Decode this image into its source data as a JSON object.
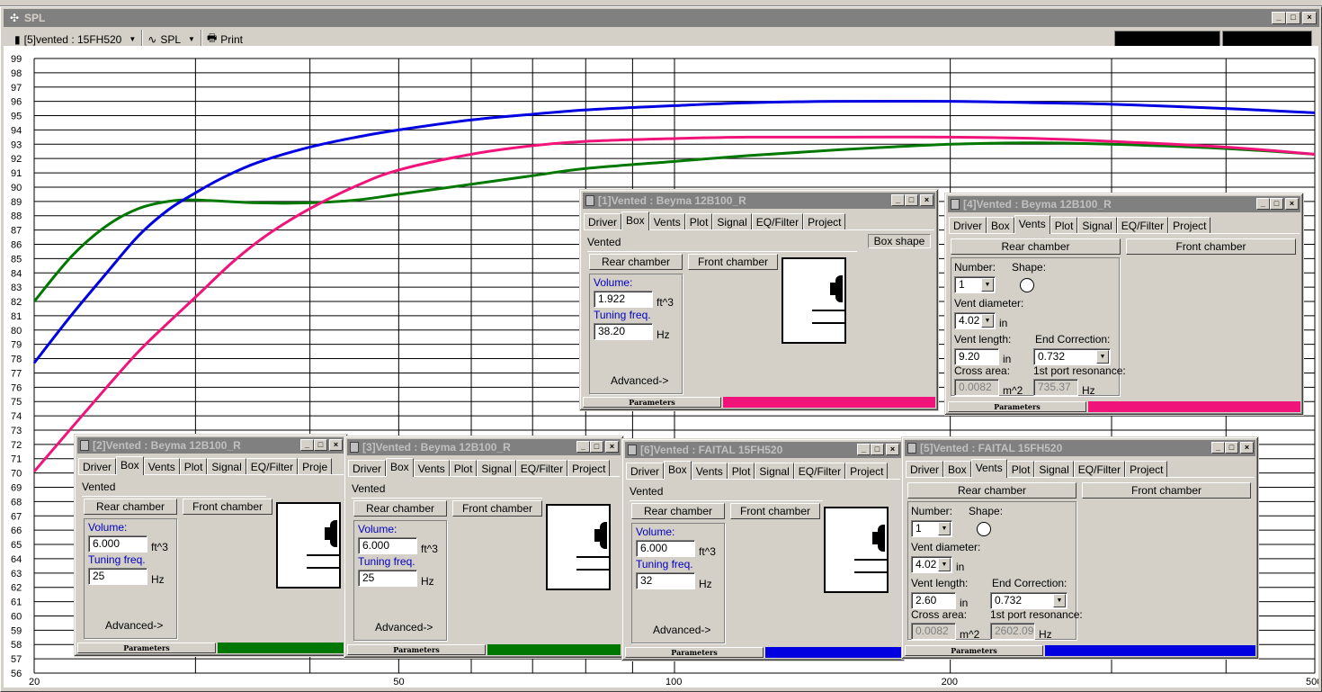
{
  "window": {
    "title": "SPL"
  },
  "toolbar": {
    "driver_select": "[5]vented : 15FH520",
    "plot_select": "SPL",
    "print_label": "Print"
  },
  "colors": {
    "green": "#007800",
    "blue": "#0000e0",
    "pink": "#f0147a"
  },
  "chart_data": {
    "type": "line",
    "x_scale": "log",
    "xlim": [
      20,
      500
    ],
    "ylim": [
      56,
      99
    ],
    "x_ticks": [
      20,
      50,
      100,
      200,
      500
    ],
    "y_ticks": [
      56,
      57,
      58,
      59,
      60,
      61,
      62,
      63,
      64,
      65,
      66,
      67,
      68,
      69,
      70,
      71,
      72,
      73,
      74,
      75,
      76,
      77,
      78,
      79,
      80,
      81,
      82,
      83,
      84,
      85,
      86,
      87,
      88,
      89,
      90,
      91,
      92,
      93,
      94,
      95,
      96,
      97,
      98,
      99
    ],
    "grid": true,
    "series": [
      {
        "color": "green",
        "x": [
          20,
          22,
          24,
          26,
          28,
          30,
          35,
          40,
          45,
          50,
          60,
          70,
          80,
          100,
          120,
          150,
          200,
          250,
          300,
          400,
          500
        ],
        "y": [
          82,
          85.2,
          87.3,
          88.5,
          89.0,
          89.1,
          88.9,
          88.9,
          89.1,
          89.5,
          90.2,
          90.8,
          91.3,
          91.8,
          92.2,
          92.6,
          93.0,
          93.1,
          93.0,
          92.7,
          92.3
        ]
      },
      {
        "color": "blue",
        "x": [
          20,
          22,
          24,
          26,
          28,
          30,
          32,
          35,
          40,
          45,
          50,
          60,
          70,
          80,
          100,
          120,
          150,
          200,
          250,
          300,
          400,
          500
        ],
        "y": [
          77.7,
          81.1,
          84.0,
          86.6,
          88.4,
          89.6,
          90.6,
          91.7,
          92.8,
          93.5,
          94.0,
          94.7,
          95.1,
          95.4,
          95.7,
          95.9,
          96.0,
          96.0,
          95.9,
          95.8,
          95.5,
          95.2
        ]
      },
      {
        "color": "pink",
        "x": [
          20,
          22,
          24,
          26,
          28,
          30,
          33,
          36,
          40,
          45,
          50,
          60,
          70,
          80,
          100,
          120,
          150,
          200,
          250,
          300,
          400,
          500
        ],
        "y": [
          70.1,
          73.2,
          76.0,
          78.5,
          80.5,
          82.3,
          84.8,
          86.7,
          88.5,
          90.1,
          91.2,
          92.3,
          92.9,
          93.2,
          93.4,
          93.5,
          93.5,
          93.5,
          93.4,
          93.2,
          92.8,
          92.3
        ]
      }
    ]
  },
  "windows": [
    {
      "title": "[1]Vented : Beyma 12B100_R",
      "tabs": [
        "Driver",
        "Box",
        "Vents",
        "Plot",
        "Signal",
        "EQ/Filter",
        "Project"
      ],
      "active_tab": "Box",
      "box": {
        "type": "Vented",
        "box_shape": "Box shape",
        "rear": "Rear chamber",
        "front": "Front chamber",
        "volume_label": "Volume:",
        "volume": "1.922",
        "volume_unit": "ft^3",
        "tuning_label": "Tuning freq.",
        "tuning": "38.20",
        "tuning_unit": "Hz",
        "advanced": "Advanced->"
      },
      "footer": "Parameters",
      "color": "#f0147a"
    },
    {
      "title": "[4]Vented : Beyma 12B100_R",
      "tabs": [
        "Driver",
        "Box",
        "Vents",
        "Plot",
        "Signal",
        "EQ/Filter",
        "Project"
      ],
      "active_tab": "Vents",
      "vents": {
        "rear": "Rear chamber",
        "front": "Front chamber",
        "number_label": "Number:",
        "number": "1",
        "shape_label": "Shape:",
        "diameter_label": "Vent diameter:",
        "diameter": "4.02",
        "diameter_unit": "in",
        "length_label": "Vent length:",
        "length": "9.20",
        "length_unit": "in",
        "endcorr_label": "End Correction:",
        "endcorr": "0.732",
        "cross_label": "Cross area:",
        "cross": "0.0082",
        "cross_unit": "m^2",
        "res_label": "1st port resonance:",
        "res": "735.37",
        "res_unit": "Hz"
      },
      "footer": "Parameters",
      "color": "#f0147a"
    },
    {
      "title": "[2]Vented : Beyma 12B100_R",
      "tabs": [
        "Driver",
        "Box",
        "Vents",
        "Plot",
        "Signal",
        "EQ/Filter",
        "Proje"
      ],
      "active_tab": "Box",
      "box": {
        "type": "Vented",
        "rear": "Rear chamber",
        "front": "Front chamber",
        "volume_label": "Volume:",
        "volume": "6.000",
        "volume_unit": "ft^3",
        "tuning_label": "Tuning freq.",
        "tuning": "25",
        "tuning_unit": "Hz",
        "advanced": "Advanced->"
      },
      "footer": "Parameters",
      "color": "#007800"
    },
    {
      "title": "[3]Vented : Beyma 12B100_R",
      "tabs": [
        "Driver",
        "Box",
        "Vents",
        "Plot",
        "Signal",
        "EQ/Filter",
        "Project"
      ],
      "active_tab": "Box",
      "box": {
        "type": "Vented",
        "rear": "Rear chamber",
        "front": "Front chamber",
        "volume_label": "Volume:",
        "volume": "6.000",
        "volume_unit": "ft^3",
        "tuning_label": "Tuning freq.",
        "tuning": "25",
        "tuning_unit": "Hz",
        "advanced": "Advanced->"
      },
      "footer": "Parameters",
      "color": "#007800"
    },
    {
      "title": "[6]Vented : FAITAL 15FH520",
      "tabs": [
        "Driver",
        "Box",
        "Vents",
        "Plot",
        "Signal",
        "EQ/Filter",
        "Project"
      ],
      "active_tab": "Box",
      "box": {
        "type": "Vented",
        "rear": "Rear chamber",
        "front": "Front chamber",
        "volume_label": "Volume:",
        "volume": "6.000",
        "volume_unit": "ft^3",
        "tuning_label": "Tuning freq.",
        "tuning": "32",
        "tuning_unit": "Hz",
        "advanced": "Advanced->"
      },
      "footer": "Parameters",
      "color": "#0000e0"
    },
    {
      "title": "[5]Vented : FAITAL 15FH520",
      "tabs": [
        "Driver",
        "Box",
        "Vents",
        "Plot",
        "Signal",
        "EQ/Filter",
        "Project"
      ],
      "active_tab": "Vents",
      "vents": {
        "rear": "Rear chamber",
        "front": "Front chamber",
        "number_label": "Number:",
        "number": "1",
        "shape_label": "Shape:",
        "diameter_label": "Vent diameter:",
        "diameter": "4.02",
        "diameter_unit": "in",
        "length_label": "Vent length:",
        "length": "2.60",
        "length_unit": "in",
        "endcorr_label": "End Correction:",
        "endcorr": "0.732",
        "cross_label": "Cross area:",
        "cross": "0.0082",
        "cross_unit": "m^2",
        "res_label": "1st port resonance:",
        "res": "2602.09",
        "res_unit": "Hz"
      },
      "footer": "Parameters",
      "color": "#0000e0"
    }
  ]
}
